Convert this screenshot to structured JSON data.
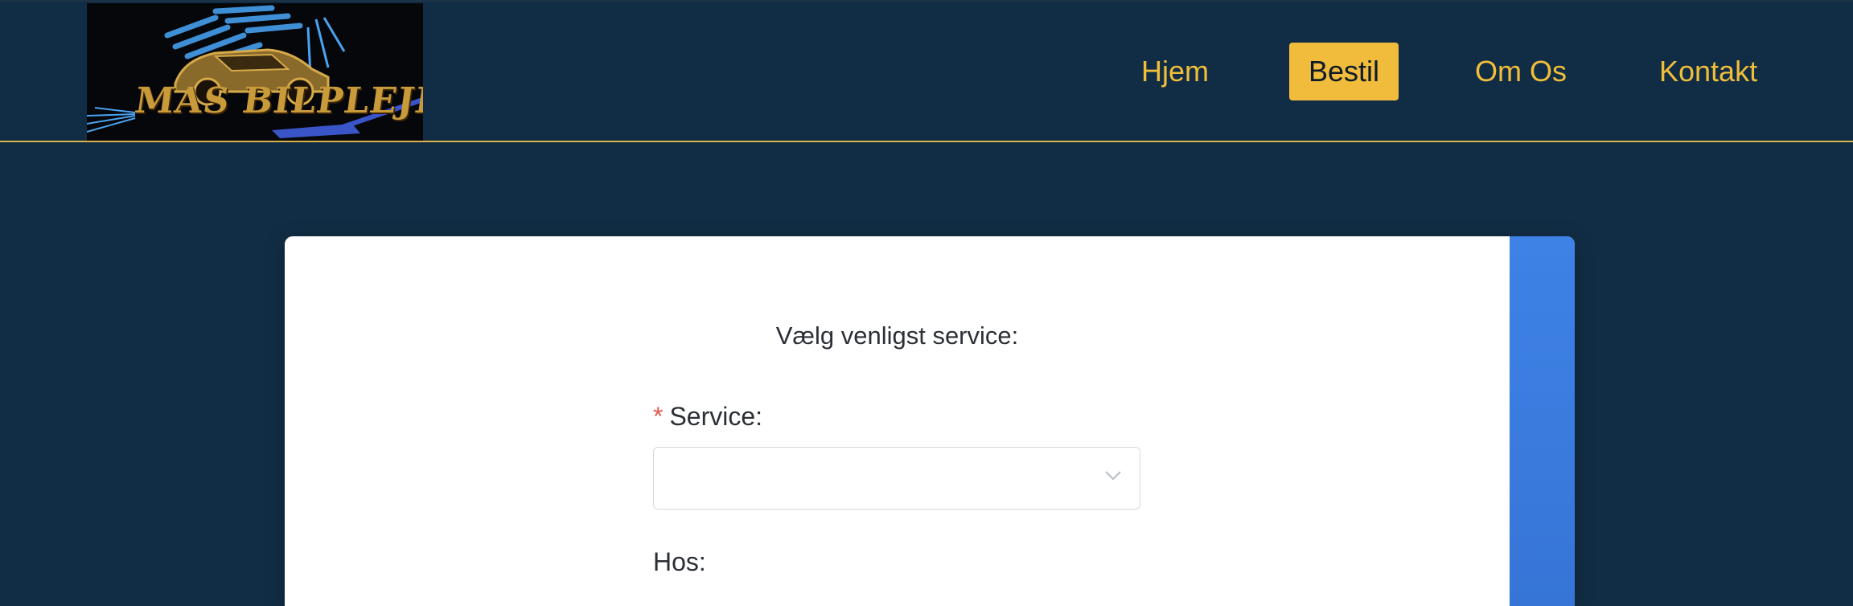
{
  "brand": {
    "logo_text": "MAS BILPLEJE",
    "logo_icon": "car-wash-logo"
  },
  "nav": {
    "items": [
      {
        "label": "Hjem",
        "active": false
      },
      {
        "label": "Bestil",
        "active": true
      },
      {
        "label": "Om Os",
        "active": false
      },
      {
        "label": "Kontakt",
        "active": false
      }
    ]
  },
  "form": {
    "heading": "Vælg venligst service:",
    "service": {
      "required_mark": "*",
      "label": "Service:",
      "value": "",
      "icon": "chevron-down-icon"
    },
    "location": {
      "label": "Hos:"
    }
  },
  "colors": {
    "background": "#112d45",
    "accent": "#f1bb3c",
    "nav_text": "#f1be3a",
    "side_panel": "#3e82e6",
    "required": "#e2594b"
  }
}
